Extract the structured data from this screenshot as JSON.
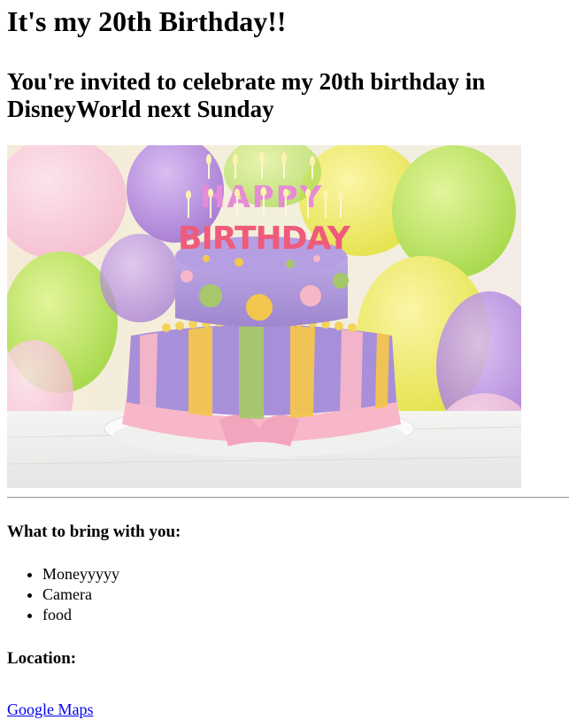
{
  "heading": "It's my 20th Birthday!!",
  "invite": "You're invited to celebrate my 20th birthday in DisneyWorld next Sunday",
  "image": {
    "cake_letters_top": "HAPPY",
    "cake_letters_bottom": "BIRTHDAY"
  },
  "bring": {
    "title": "What to bring with you:",
    "items": [
      "Moneyyyyy",
      "Camera",
      "food"
    ]
  },
  "location": {
    "title": "Location:",
    "link_text": "Google Maps"
  },
  "colors": {
    "link": "#0000ee",
    "text": "#000000",
    "cake_purple": "#a98fd6",
    "cake_pink": "#f7b7c9",
    "cake_yellow": "#f3c64e",
    "cake_green": "#a6c86a"
  }
}
